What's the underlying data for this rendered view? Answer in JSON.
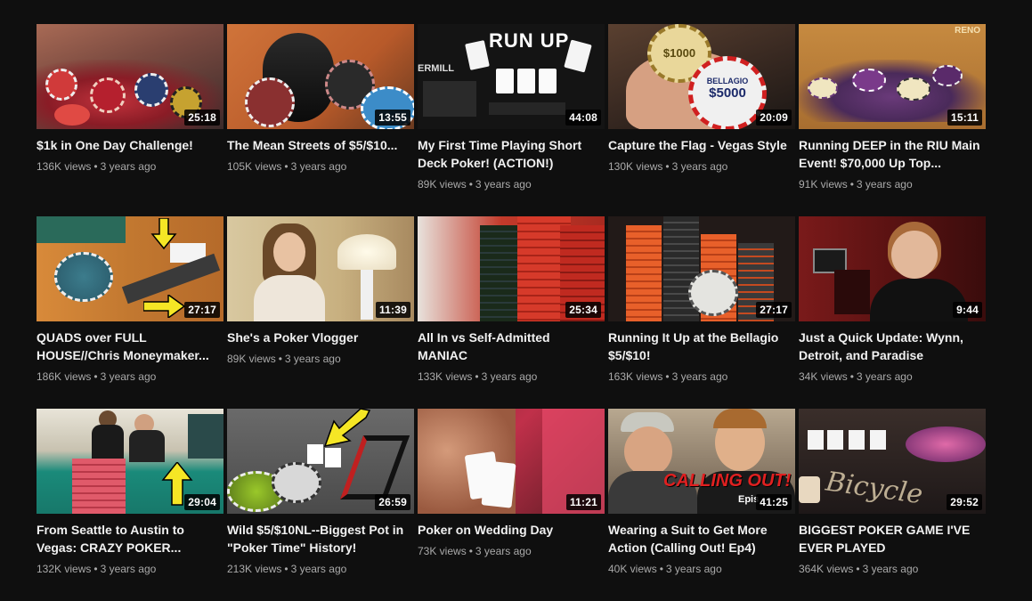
{
  "videos": [
    {
      "title": "$1k in One Day Challenge!",
      "views": "136K views",
      "age": "3 years ago",
      "duration": "25:18"
    },
    {
      "title": "The Mean Streets of $5/$10...",
      "views": "105K views",
      "age": "3 years ago",
      "duration": "13:55"
    },
    {
      "title": "My First Time Playing Short Deck Poker! (ACTION!)",
      "views": "89K views",
      "age": "3 years ago",
      "duration": "44:08"
    },
    {
      "title": "Capture the Flag - Vegas Style",
      "views": "130K views",
      "age": "3 years ago",
      "duration": "20:09"
    },
    {
      "title": "Running DEEP in the RIU Main Event! $70,000 Up Top...",
      "views": "91K views",
      "age": "3 years ago",
      "duration": "15:11"
    },
    {
      "title": "QUADS over FULL HOUSE//Chris Moneymaker...",
      "views": "186K views",
      "age": "3 years ago",
      "duration": "27:17"
    },
    {
      "title": "She's a Poker Vlogger",
      "views": "89K views",
      "age": "3 years ago",
      "duration": "11:39"
    },
    {
      "title": "All In vs Self-Admitted MANIAC",
      "views": "133K views",
      "age": "3 years ago",
      "duration": "25:34"
    },
    {
      "title": "Running It Up at the Bellagio $5/$10!",
      "views": "163K views",
      "age": "3 years ago",
      "duration": "27:17"
    },
    {
      "title": "Just a Quick Update: Wynn, Detroit, and Paradise",
      "views": "34K views",
      "age": "3 years ago",
      "duration": "9:44"
    },
    {
      "title": "From Seattle to Austin to Vegas: CRAZY POKER...",
      "views": "132K views",
      "age": "3 years ago",
      "duration": "29:04"
    },
    {
      "title": "Wild $5/$10NL--Biggest Pot in \"Poker Time\" History!",
      "views": "213K views",
      "age": "3 years ago",
      "duration": "26:59"
    },
    {
      "title": "Poker on Wedding Day",
      "views": "73K views",
      "age": "3 years ago",
      "duration": "11:21"
    },
    {
      "title": "Wearing a Suit to Get More Action (Calling Out! Ep4)",
      "views": "40K views",
      "age": "3 years ago",
      "duration": "41:25"
    },
    {
      "title": "BIGGEST POKER GAME I'VE EVER PLAYED",
      "views": "364K views",
      "age": "3 years ago",
      "duration": "29:52"
    }
  ],
  "thumb_text": {
    "t3_runup": "RUN UP",
    "t3_mill": "ERMILL",
    "t4_chip1": "$1000",
    "t4_chip2": "$5000",
    "t4_bellagio": "BELLAGIO",
    "t5_reno": "RENO",
    "t14_calling": "CALLING OUT!",
    "t14_epis": "Epis",
    "t15_bicycle": "Bicycle"
  },
  "colors": {
    "background": "#0f0f0f",
    "title": "#f1f1f1",
    "meta": "#aaaaaa",
    "arrow": "#f5e625"
  }
}
